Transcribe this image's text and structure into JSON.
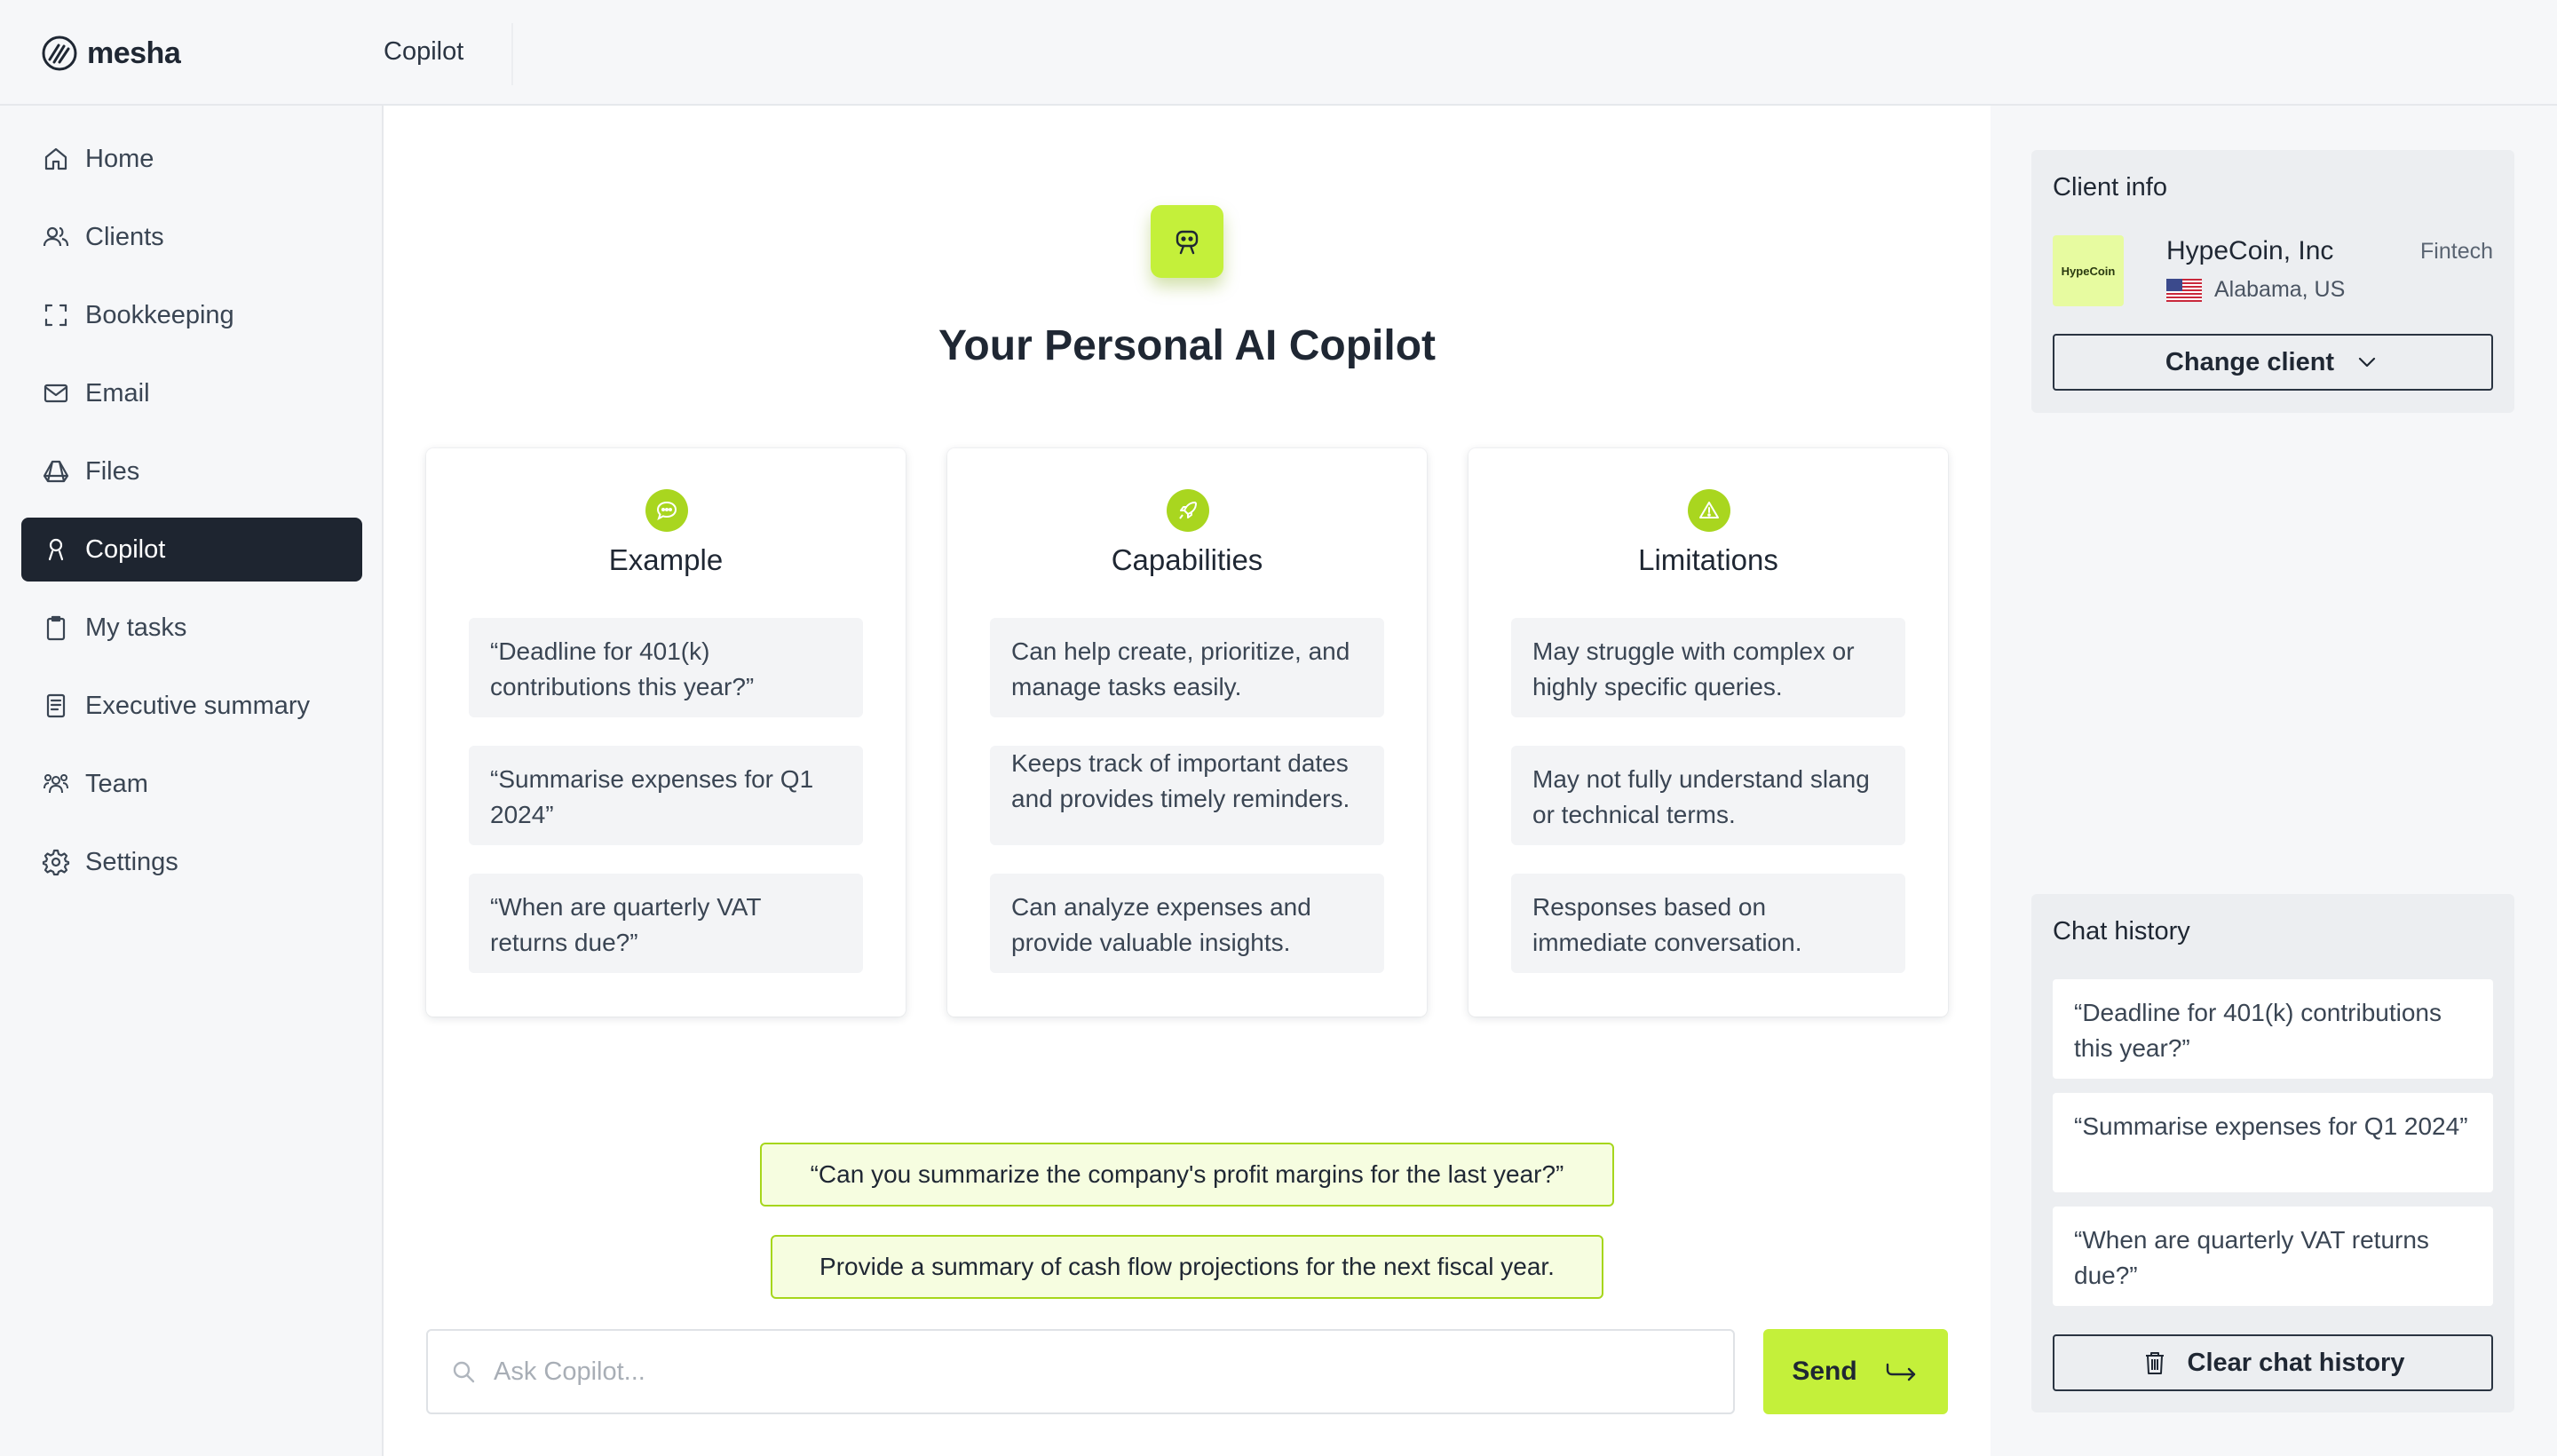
{
  "app": {
    "logo_text": "mesha",
    "section_title": "Copilot"
  },
  "sidebar": {
    "items": [
      {
        "label": "Home",
        "icon": "home-icon"
      },
      {
        "label": "Clients",
        "icon": "users-icon"
      },
      {
        "label": "Bookkeeping",
        "icon": "scan-icon"
      },
      {
        "label": "Email",
        "icon": "mail-icon"
      },
      {
        "label": "Files",
        "icon": "drive-icon"
      },
      {
        "label": "Copilot",
        "icon": "copilot-icon",
        "active": true
      },
      {
        "label": "My tasks",
        "icon": "clipboard-icon"
      },
      {
        "label": "Executive summary",
        "icon": "document-icon"
      },
      {
        "label": "Team",
        "icon": "team-icon"
      },
      {
        "label": "Settings",
        "icon": "gear-icon"
      }
    ]
  },
  "hero": {
    "title": "Your Personal AI Copilot",
    "icon": "robot-icon"
  },
  "cards": [
    {
      "title": "Example",
      "icon": "chat-icon",
      "items": [
        "“Deadline for 401(k) contributions this year?”",
        "“Summarise expenses for Q1 2024”",
        "“When are quarterly VAT returns due?”"
      ]
    },
    {
      "title": "Capabilities",
      "icon": "rocket-icon",
      "items": [
        "Can help create, prioritize, and manage tasks easily.",
        "Keeps track of important dates and provides timely reminders.",
        "Can analyze expenses and provide valuable insights."
      ]
    },
    {
      "title": "Limitations",
      "icon": "warning-icon",
      "items": [
        "May struggle with complex or highly specific queries.",
        "May not fully understand slang or technical terms.",
        "Responses based on immediate conversation."
      ]
    }
  ],
  "suggestions": [
    "“Can you summarize the company's profit margins for the last year?”",
    "Provide a summary of cash flow projections for the next fiscal year."
  ],
  "input": {
    "placeholder": "Ask Copilot...",
    "value": ""
  },
  "send_label": "Send",
  "client_info": {
    "title": "Client info",
    "logo_text": "HypeCoin",
    "name": "HypeCoin, Inc",
    "category": "Fintech",
    "location": "Alabama, US",
    "change_label": "Change client"
  },
  "chat_history": {
    "title": "Chat history",
    "items": [
      "“Deadline for 401(k) contributions this year?”",
      "“Summarise expenses for Q1 2024”",
      "“When are quarterly VAT returns due?”"
    ],
    "clear_label": "Clear chat history"
  },
  "colors": {
    "accent": "#c4f03a",
    "accent_dark": "#a9d61f",
    "nav_active": "#1e2530"
  }
}
